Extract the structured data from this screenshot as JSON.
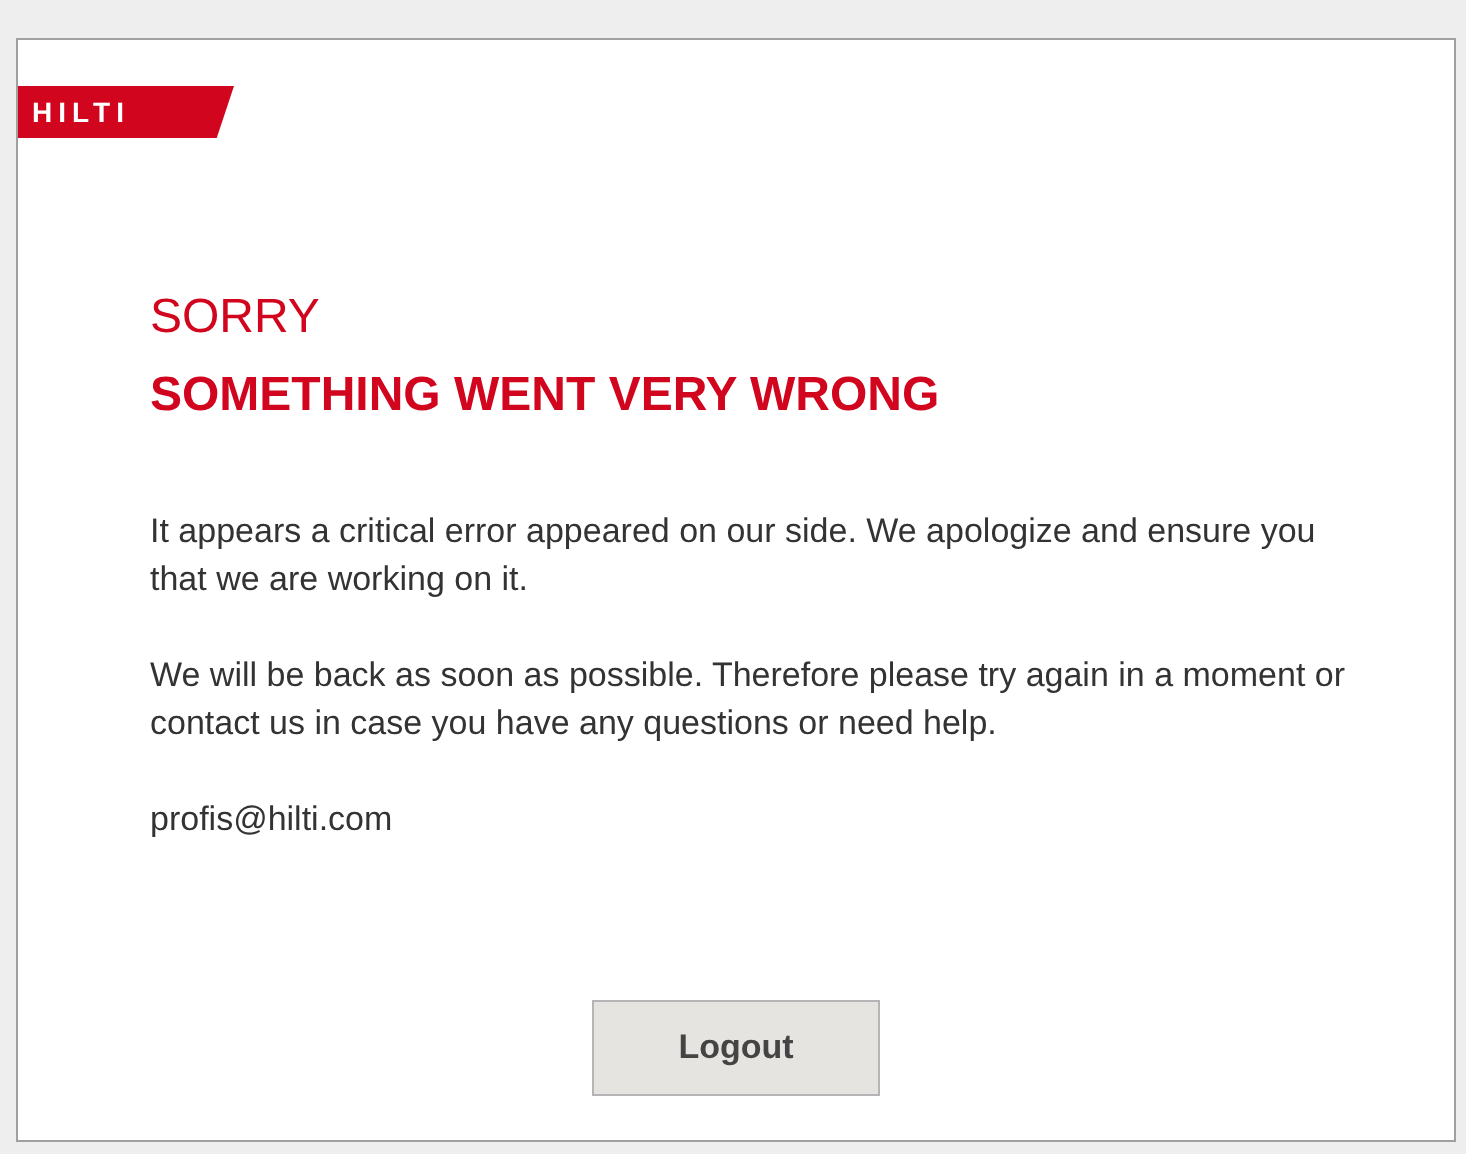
{
  "logo": {
    "text": "HILTI"
  },
  "title": "SORRY",
  "heading": "SOMETHING WENT VERY WRONG",
  "paragraphs": [
    "It appears a critical error appeared on our side. We apologize and ensure you that we are working on it.",
    "We will be back as soon as possible. Therefore please try again in a moment or contact us in case you have any questions or need help."
  ],
  "email": "profis@hilti.com",
  "button": "Logout"
}
